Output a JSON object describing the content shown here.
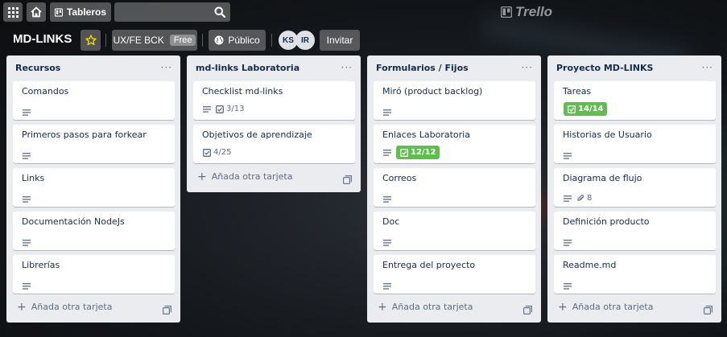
{
  "header": {
    "boards_label": "Tableros",
    "logo_text": "Trello",
    "search_placeholder": ""
  },
  "board": {
    "title": "MD-LINKS",
    "team": "UX/FE BCK",
    "plan_badge": "Free",
    "visibility": "Público",
    "members": [
      "KS",
      "IR"
    ],
    "invite_label": "Invitar"
  },
  "add_card_label": "Añada otra tarjeta",
  "colors": {
    "list_bg": "#ebecf0",
    "checklist_done": "#61bd4f",
    "star": "#f2d600"
  },
  "lists": [
    {
      "title": "Recursos",
      "cards": [
        {
          "title": "Comandos",
          "desc": true
        },
        {
          "title": "Primeros pasos para forkear",
          "desc": true
        },
        {
          "title": "Links",
          "desc": true
        },
        {
          "title": "Documentación NodeJs",
          "desc": true
        },
        {
          "title": "Librerías",
          "desc": true
        }
      ]
    },
    {
      "title": "md-links Laboratoria",
      "cards": [
        {
          "title": "Checklist md-links",
          "desc": true,
          "checklist": "3/13",
          "done": false
        },
        {
          "title": "Objetivos de aprendizaje",
          "desc": false,
          "checklist": "4/25",
          "done": false
        }
      ]
    },
    {
      "title": "Formularios / Fijos",
      "cards": [
        {
          "title": "Miró (product backlog)",
          "desc": true
        },
        {
          "title": "Enlaces Laboratoria",
          "desc": true,
          "checklist": "12/12",
          "done": true
        },
        {
          "title": "Correos",
          "desc": true
        },
        {
          "title": "Doc",
          "desc": true
        },
        {
          "title": "Entrega del proyecto",
          "desc": true
        }
      ]
    },
    {
      "title": "Proyecto MD-LINKS",
      "cards": [
        {
          "title": "Tareas",
          "desc": false,
          "checklist": "14/14",
          "done": true
        },
        {
          "title": "Historias de Usuario",
          "desc": true
        },
        {
          "title": "Diagrama de flujo",
          "desc": true,
          "attachments": "8"
        },
        {
          "title": "Definición producto",
          "desc": true
        },
        {
          "title": "Readme.md",
          "desc": true
        }
      ]
    }
  ]
}
